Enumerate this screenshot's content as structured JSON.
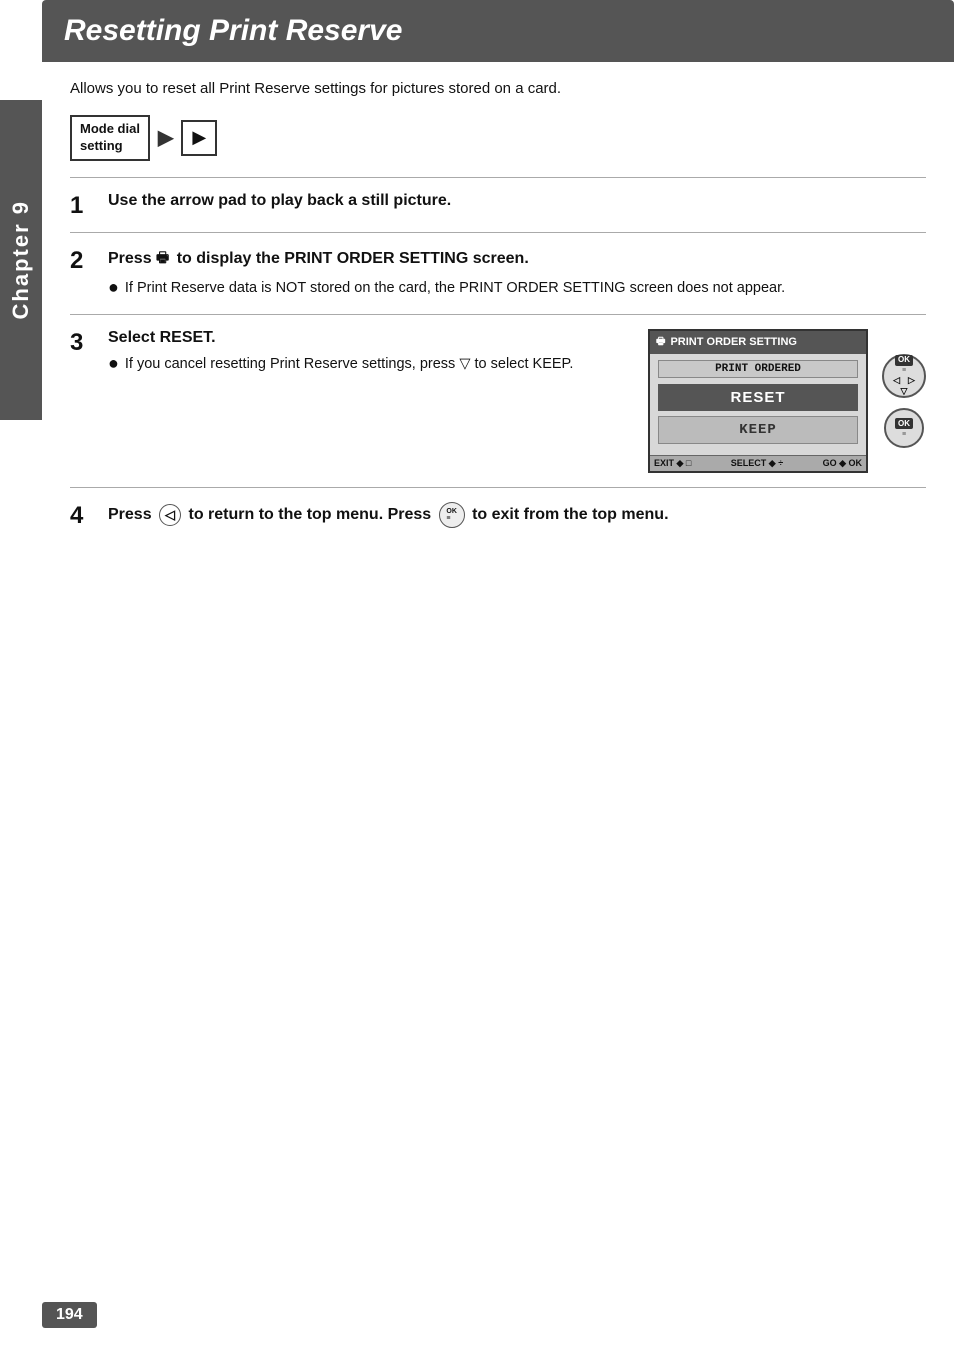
{
  "page": {
    "number": "194",
    "chapter_label": "Chapter 9"
  },
  "title": "Resetting Print Reserve",
  "intro": "Allows you to reset all Print Reserve settings for pictures stored on a card.",
  "mode_dial": {
    "label_line1": "Mode dial",
    "label_line2": "setting",
    "play_icon": "▶"
  },
  "steps": [
    {
      "number": "1",
      "title": "Use the arrow pad to play back a still picture.",
      "body": ""
    },
    {
      "number": "2",
      "title": "Press  to display the PRINT ORDER SETTING screen.",
      "body": "If Print Reserve data is NOT stored on the card, the PRINT ORDER SETTING screen does not appear.",
      "print_icon": "🖶"
    },
    {
      "number": "3",
      "title": "Select RESET.",
      "bullet": "If you cancel resetting Print Reserve settings, press ▽ to select KEEP.",
      "screen": {
        "title": "PRINT ORDER SETTING",
        "sub": "PRINT ORDERED",
        "btn_reset": "RESET",
        "btn_keep": "KEEP",
        "footer_exit": "EXIT ◆ □",
        "footer_select": "SELECT ◆ ÷",
        "footer_go": "GO ◆ OK"
      }
    },
    {
      "number": "4",
      "text": "Press  ◁  to return to the top menu. Press   to exit from the top menu."
    }
  ]
}
